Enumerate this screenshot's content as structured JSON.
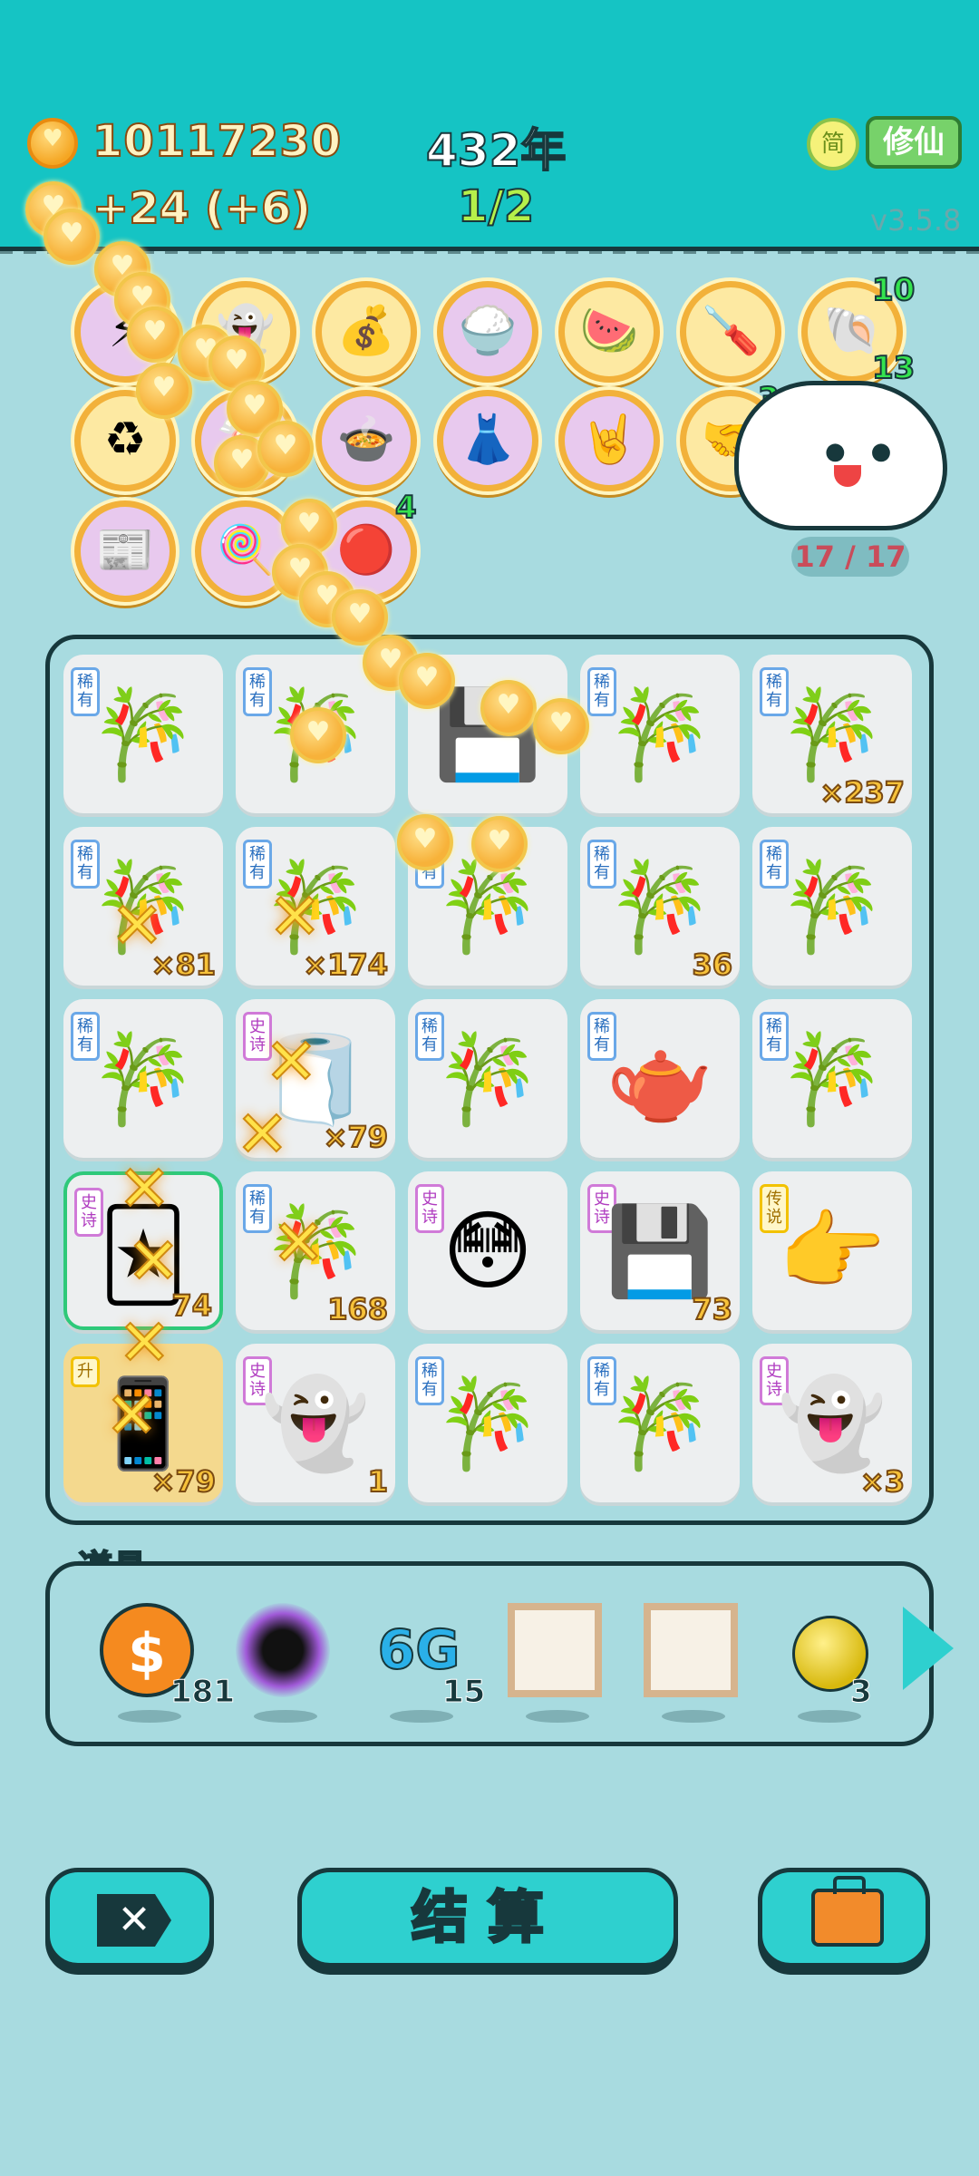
{
  "header": {
    "coins": "10117230",
    "rate": "+24  (+6)",
    "year": "432年",
    "wave": "1/2",
    "lang_toggle": "简",
    "mode_label": "修仙",
    "version": "v3.5.8"
  },
  "relics": [
    {
      "icon": "lightning-icon",
      "glyph": "⚡"
    },
    {
      "icon": "ghost-icon",
      "glyph": "👻"
    },
    {
      "icon": "sack-icon",
      "glyph": "💰"
    },
    {
      "icon": "rice-bowls-icon",
      "glyph": "🍚"
    },
    {
      "icon": "fruit-bowl-icon",
      "glyph": "🍉"
    },
    {
      "icon": "screwdriver-icon",
      "glyph": "🪛"
    },
    {
      "icon": "shell-icon",
      "glyph": "🐚"
    },
    {
      "icon": "recycle-icon",
      "glyph": "♻"
    },
    {
      "icon": "unknown-relic-icon",
      "glyph": "🍬"
    },
    {
      "icon": "duck-pot-icon",
      "glyph": "🍲"
    },
    {
      "icon": "skirt-icon",
      "glyph": "👗"
    },
    {
      "icon": "rock-hand-icon",
      "glyph": "🤘"
    },
    {
      "icon": "handshake-icon",
      "glyph": "🤝"
    },
    {
      "icon": "time-magazine-icon",
      "glyph": "📰"
    },
    {
      "icon": "candy-icon",
      "glyph": "🍭"
    },
    {
      "icon": "red-relic-icon",
      "glyph": "🔴"
    }
  ],
  "relic_badges": {
    "shell_top": "10",
    "shell_bottom": "13",
    "handshake": "3",
    "pot": "4"
  },
  "cloud": {
    "hp": "17 / 17"
  },
  "tags": {
    "rare": "稀有",
    "epic": "史诗",
    "legend": "传说",
    "upgrade": "升"
  },
  "board": [
    {
      "tag": "rare",
      "icon": "bamboo-icon",
      "glyph": "🎋",
      "count": ""
    },
    {
      "tag": "rare",
      "icon": "bamboo-icon",
      "glyph": "🎋",
      "count": ""
    },
    {
      "tag": "",
      "icon": "gpu-icon",
      "glyph": "💾",
      "count": ""
    },
    {
      "tag": "rare",
      "icon": "bamboo-icon",
      "glyph": "🎋",
      "count": ""
    },
    {
      "tag": "rare",
      "icon": "bamboo-icon",
      "glyph": "🎋",
      "count": "×237"
    },
    {
      "tag": "rare",
      "icon": "bamboo-icon",
      "glyph": "🎋",
      "count": "×81"
    },
    {
      "tag": "rare",
      "icon": "bamboo-icon",
      "glyph": "🎋",
      "count": "×174"
    },
    {
      "tag": "rare",
      "icon": "bamboo-moon-icon",
      "glyph": "🎋",
      "count": ""
    },
    {
      "tag": "rare",
      "icon": "bamboo-star-icon",
      "glyph": "🎋",
      "count": "36"
    },
    {
      "tag": "rare",
      "icon": "bamboo-icon",
      "glyph": "🎋",
      "count": ""
    },
    {
      "tag": "rare",
      "icon": "bamboo-bubble-icon",
      "glyph": "🎋",
      "count": ""
    },
    {
      "tag": "epic",
      "icon": "cloth-icon",
      "glyph": "🧻",
      "count": "×79"
    },
    {
      "tag": "rare",
      "icon": "bamboo-icon",
      "glyph": "🎋",
      "count": ""
    },
    {
      "tag": "rare",
      "icon": "teapot-icon",
      "glyph": "🫖",
      "count": ""
    },
    {
      "tag": "rare",
      "icon": "bamboo-icon",
      "glyph": "🎋",
      "count": ""
    },
    {
      "tag": "epic",
      "icon": "card-icon",
      "glyph": "🃏",
      "count": "74"
    },
    {
      "tag": "rare",
      "icon": "bamboo-icon",
      "glyph": "🎋",
      "count": "168"
    },
    {
      "tag": "epic",
      "icon": "face-icon",
      "glyph": "😳",
      "count": ""
    },
    {
      "tag": "epic",
      "icon": "gpu-icon",
      "glyph": "💾",
      "count": "73"
    },
    {
      "tag": "legend",
      "icon": "pointing-hand-icon",
      "glyph": "👉",
      "count": ""
    },
    {
      "tag": "upgrade",
      "icon": "phone-icon",
      "glyph": "📱",
      "count": "×79"
    },
    {
      "tag": "epic",
      "icon": "dead-ghost-icon",
      "glyph": "👻",
      "count": "1"
    },
    {
      "tag": "rare",
      "icon": "bamboo-icon",
      "glyph": "🎋",
      "count": ""
    },
    {
      "tag": "rare",
      "icon": "bamboo-icon",
      "glyph": "🎋",
      "count": ""
    },
    {
      "tag": "epic",
      "icon": "dead-ghost-icon",
      "glyph": "👻",
      "count": "×3"
    }
  ],
  "props": {
    "title": "道具",
    "items": [
      {
        "icon": "dollar-coin-icon",
        "glyph": "$",
        "qty": "181"
      },
      {
        "icon": "black-hole-icon",
        "glyph": "●",
        "qty": ""
      },
      {
        "icon": "6g-icon",
        "glyph": "6G",
        "qty": "15"
      },
      {
        "icon": "blank-frame-icon",
        "glyph": "▢",
        "qty": ""
      },
      {
        "icon": "blank-frame-icon",
        "glyph": "▢",
        "qty": ""
      },
      {
        "icon": "gold-ball-icon",
        "glyph": "●",
        "qty": "3"
      }
    ]
  },
  "buttons": {
    "exit": "✕",
    "settle": "结算",
    "bag": ""
  }
}
